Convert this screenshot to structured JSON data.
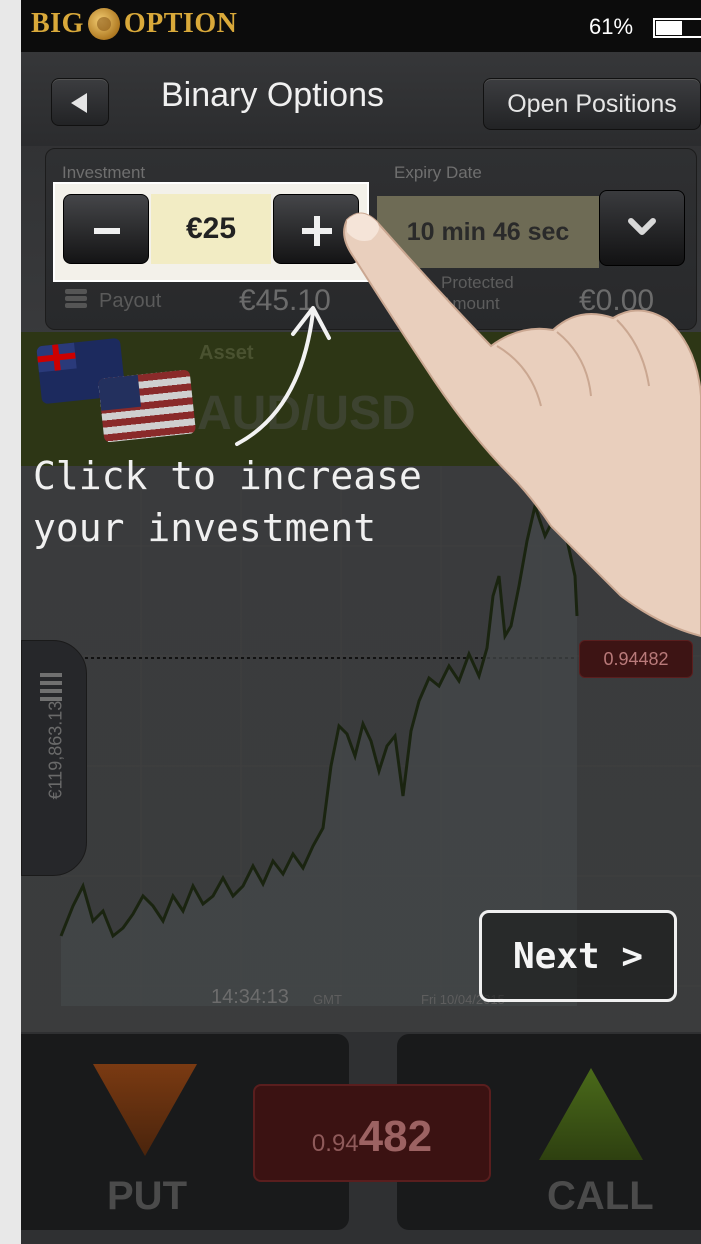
{
  "status_bar": {
    "brand_left": "BIG",
    "brand_right": "OPTION",
    "battery": "61%"
  },
  "nav": {
    "title": "Binary Options",
    "open_positions": "Open Positions"
  },
  "trade": {
    "investment_label": "Investment",
    "investment_value": "€25",
    "expiry_label": "Expiry Date",
    "expiry_value": "10 min 46 sec",
    "payout_label": "Payout",
    "payout_value": "€45.10",
    "protected_label": "Protected Amount",
    "protected_value": "€0.00"
  },
  "asset": {
    "label": "Asset",
    "name": "AUD/USD"
  },
  "chart": {
    "current_price": "0.94482",
    "time": "14:34:13",
    "timezone": "GMT",
    "date": "Fri 10/04/2015",
    "balance": "€119,863.13"
  },
  "tutorial": {
    "text": "Click to increase your investment",
    "next": "Next >"
  },
  "bottom": {
    "put": "PUT",
    "call": "CALL",
    "rate_prefix": "0.94",
    "rate_suffix": "482"
  },
  "colors": {
    "brand_gold": "#d9a93a",
    "asset_bar": "#2d3615",
    "put": "#b0551a",
    "call": "#5c7a20"
  }
}
